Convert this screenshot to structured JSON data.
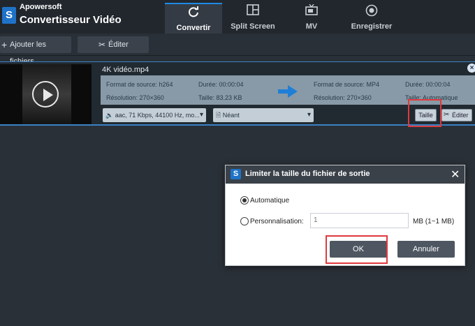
{
  "app": {
    "brand": "Apowersoft",
    "title": "Convertisseur Vidéo"
  },
  "tabs": [
    {
      "label": "Convertir",
      "icon": "refresh-icon",
      "active": true
    },
    {
      "label": "Split Screen",
      "icon": "split-screen-icon"
    },
    {
      "label": "MV",
      "icon": "tv-icon"
    },
    {
      "label": "Enregistrer",
      "icon": "record-icon"
    }
  ],
  "toolbar": {
    "add_files": "Ajouter les fichiers",
    "edit": "Éditer"
  },
  "file": {
    "name": "4K vidéo.mp4",
    "source": {
      "format": "Format de source: h264",
      "duration": "Durée: 00:00:04",
      "resolution": "Résolution: 270×360",
      "size": "Taille: 83.23 KB"
    },
    "output": {
      "format": "Format de source: MP4",
      "duration": "Durée: 00:00:04",
      "resolution": "Résolution: 270×360",
      "size": "Taille: Automatique"
    },
    "audio_select": "aac, 71 Kbps, 44100 Hz, mo...",
    "subtitle_select": "Néant",
    "size_button": "Taille",
    "edit_button": "Éditer"
  },
  "dialog": {
    "title": "Limiter la taille du fichier de sortie",
    "option_auto": "Automatique",
    "option_custom": "Personnalisation:",
    "custom_value": "1",
    "unit": "MB (1~1 MB)",
    "ok": "OK",
    "cancel": "Annuler"
  },
  "colors": {
    "accent": "#1f8ae6",
    "highlight": "#e0393e"
  }
}
